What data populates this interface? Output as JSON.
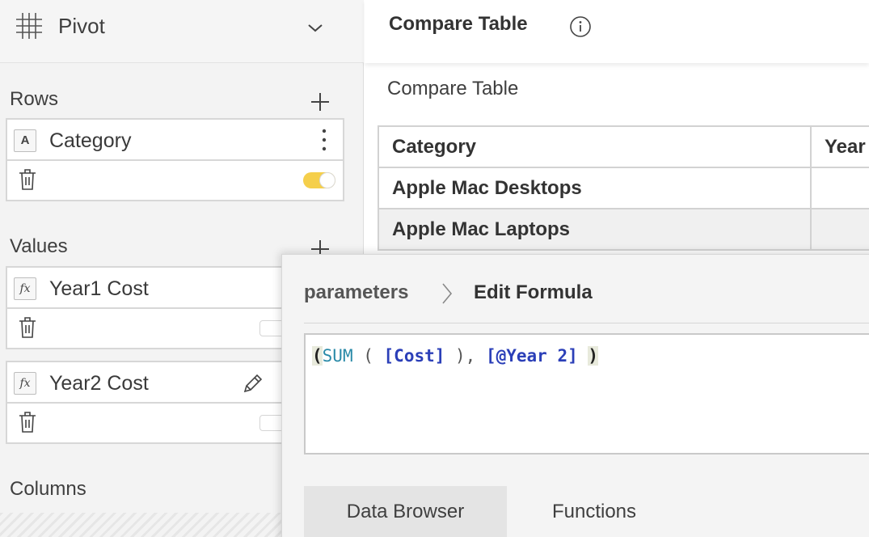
{
  "pivot": {
    "title": "Pivot",
    "icon": "grid-icon",
    "sections": {
      "rows": {
        "label": "Rows",
        "fields": [
          {
            "name": "Category",
            "type_badge": "A",
            "toggle_on": true
          }
        ]
      },
      "values": {
        "label": "Values",
        "fields": [
          {
            "name": "Year1 Cost",
            "type_badge": "fx",
            "toggle_on": false
          },
          {
            "name": "Year2 Cost",
            "type_badge": "fx",
            "toggle_on": false
          }
        ]
      },
      "columns": {
        "label": "Columns"
      }
    },
    "colors": {
      "toggle_on": "#f5cf4b",
      "panel_bg": "#f3f3f3"
    }
  },
  "report": {
    "header_title": "Compare Table",
    "caption": "Compare Table",
    "table": {
      "columns": [
        "Category",
        "Year"
      ],
      "rows": [
        [
          "Apple Mac Desktops",
          ""
        ],
        [
          "Apple Mac Laptops",
          ""
        ]
      ]
    }
  },
  "formula_dialog": {
    "breadcrumb": {
      "previous": "parameters",
      "current": "Edit Formula"
    },
    "formula_tokens": {
      "open_paren": "(",
      "function": "SUM",
      "fn_open": " ( ",
      "field1": "[Cost]",
      "fn_close": " ), ",
      "field2": "[@Year 2]",
      "space": " ",
      "close_paren": ")"
    },
    "colors": {
      "function": "#2a8aa8",
      "field": "#2b3fb8",
      "paren_highlight": "#e8eadc"
    },
    "tabs": [
      {
        "label": "Data Browser",
        "active": true
      },
      {
        "label": "Functions",
        "active": false
      }
    ]
  }
}
